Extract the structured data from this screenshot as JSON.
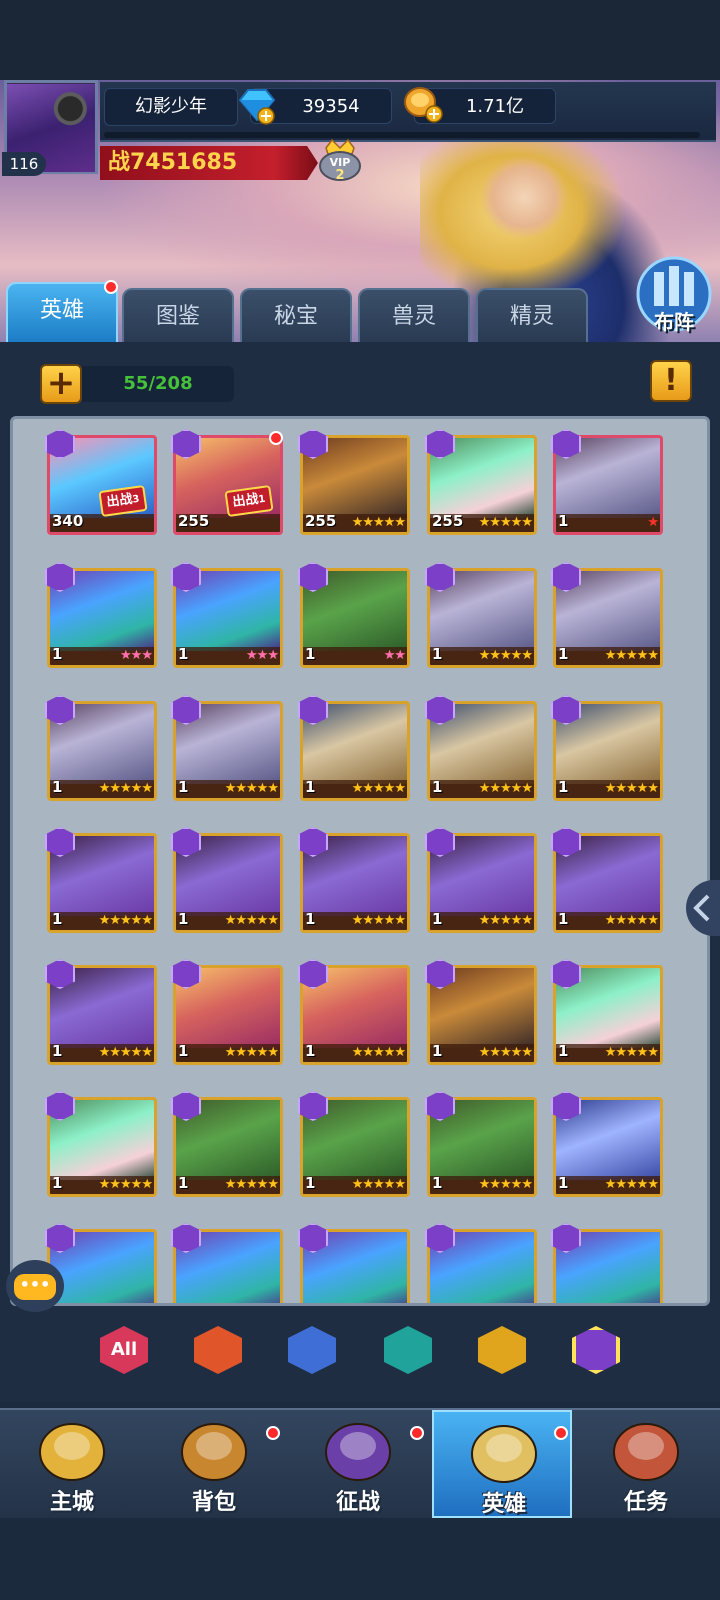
{
  "player": {
    "name": "幻影少年",
    "level": "116",
    "power": "战7451685",
    "vip": "VIP",
    "vip_level": "2"
  },
  "currency": {
    "diamonds": "39354",
    "gold": "1.71亿"
  },
  "tabs": [
    {
      "label": "英雄",
      "active": true,
      "red_dot": true
    },
    {
      "label": "图鉴"
    },
    {
      "label": "秘宝"
    },
    {
      "label": "兽灵"
    },
    {
      "label": "精灵"
    }
  ],
  "formation_button": "布阵",
  "hero_count": "55/208",
  "info_button": "!",
  "add_button": "+",
  "deploy_label": "出战",
  "heroes": [
    {
      "level": "340",
      "stars": "",
      "deploy": "3",
      "art": "cyan"
    },
    {
      "level": "255",
      "stars": "",
      "deploy": "1",
      "art": "gold",
      "red_dot": true
    },
    {
      "level": "255",
      "stars": "★★★★★",
      "art": "bronze"
    },
    {
      "level": "255",
      "stars": "★★★★★",
      "art": "green"
    },
    {
      "level": "1",
      "stars": "★",
      "star_color": "red",
      "art": "pale"
    },
    {
      "level": "1",
      "stars": "★★★",
      "star_color": "pink",
      "art": "blue"
    },
    {
      "level": "1",
      "stars": "★★★",
      "star_color": "pink",
      "art": "blue"
    },
    {
      "level": "1",
      "stars": "★★",
      "star_color": "pink",
      "art": "frog"
    },
    {
      "level": "1",
      "stars": "★★★★★",
      "art": "pale"
    },
    {
      "level": "1",
      "stars": "★★★★★",
      "art": "pale"
    },
    {
      "level": "1",
      "stars": "★★★★★",
      "art": "pale"
    },
    {
      "level": "1",
      "stars": "★★★★★",
      "art": "pale"
    },
    {
      "level": "1",
      "stars": "★★★★★",
      "art": "tiger"
    },
    {
      "level": "1",
      "stars": "★★★★★",
      "art": "tiger"
    },
    {
      "level": "1",
      "stars": "★★★★★",
      "art": "tiger"
    },
    {
      "level": "1",
      "stars": "★★★★★",
      "art": "purple"
    },
    {
      "level": "1",
      "stars": "★★★★★",
      "art": "purple"
    },
    {
      "level": "1",
      "stars": "★★★★★",
      "art": "purple"
    },
    {
      "level": "1",
      "stars": "★★★★★",
      "art": "purple"
    },
    {
      "level": "1",
      "stars": "★★★★★",
      "art": "purple"
    },
    {
      "level": "1",
      "stars": "★★★★★",
      "art": "purple"
    },
    {
      "level": "1",
      "stars": "★★★★★",
      "art": "gold"
    },
    {
      "level": "1",
      "stars": "★★★★★",
      "art": "gold"
    },
    {
      "level": "1",
      "stars": "★★★★★",
      "art": "bronze"
    },
    {
      "level": "1",
      "stars": "★★★★★",
      "art": "green"
    },
    {
      "level": "1",
      "stars": "★★★★★",
      "art": "green"
    },
    {
      "level": "1",
      "stars": "★★★★★",
      "art": "frog"
    },
    {
      "level": "1",
      "stars": "★★★★★",
      "art": "frog"
    },
    {
      "level": "1",
      "stars": "★★★★★",
      "art": "frog"
    },
    {
      "level": "1",
      "stars": "★★★★★",
      "art": "navy"
    },
    {
      "level": "",
      "stars": "",
      "art": "blue"
    },
    {
      "level": "",
      "stars": "",
      "art": "blue"
    },
    {
      "level": "",
      "stars": "",
      "art": "blue"
    },
    {
      "level": "",
      "stars": "",
      "art": "blue"
    },
    {
      "level": "",
      "stars": "",
      "art": "blue"
    }
  ],
  "filters": [
    {
      "label": "All",
      "color": "#d8385a",
      "icon": "all-filter-icon"
    },
    {
      "label": "",
      "color": "#e0552a",
      "icon": "fire-class-icon"
    },
    {
      "label": "",
      "color": "#3f6fd6",
      "icon": "cross-class-icon"
    },
    {
      "label": "",
      "color": "#1fa39a",
      "icon": "skull-class-icon"
    },
    {
      "label": "",
      "color": "#e0a51c",
      "icon": "wing-class-icon"
    },
    {
      "label": "",
      "color": "#7b3fc8",
      "icon": "demon-class-icon",
      "selected": true
    }
  ],
  "nav": [
    {
      "label": "主城",
      "icon": "castle-icon"
    },
    {
      "label": "背包",
      "icon": "chest-icon",
      "red_dot": true
    },
    {
      "label": "征战",
      "icon": "dragon-portal-icon",
      "red_dot": true
    },
    {
      "label": "英雄",
      "icon": "helmet-icon",
      "active": true,
      "red_dot": true
    },
    {
      "label": "任务",
      "icon": "scroll-icon"
    }
  ],
  "chat_icon": "•••"
}
